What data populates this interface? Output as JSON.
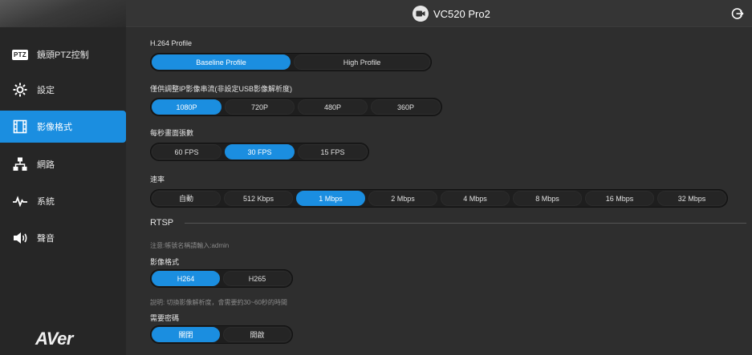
{
  "header": {
    "device_name": "VC520 Pro2"
  },
  "sidebar": {
    "items": [
      {
        "badge": "PTZ",
        "label": "鏡頭PTZ控制",
        "icon": "ptz-badge-icon"
      },
      {
        "label": "設定",
        "icon": "gear-icon"
      },
      {
        "label": "影像格式",
        "icon": "video-format-icon",
        "active": true
      },
      {
        "label": "網路",
        "icon": "network-icon"
      },
      {
        "label": "系統",
        "icon": "pulse-icon"
      },
      {
        "label": "聲音",
        "icon": "speaker-icon"
      }
    ],
    "logo": "AVer"
  },
  "h264_profile": {
    "label": "H.264 Profile",
    "options": [
      "Baseline Profile",
      "High Profile"
    ],
    "selected": "Baseline Profile"
  },
  "ip_resolution": {
    "label": "僅供調整IP影像串流(非設定USB影像解析度)",
    "options": [
      "1080P",
      "720P",
      "480P",
      "360P"
    ],
    "selected": "1080P"
  },
  "fps": {
    "label": "每秒畫面張數",
    "options": [
      "60 FPS",
      "30 FPS",
      "15 FPS"
    ],
    "selected": "30 FPS"
  },
  "bitrate": {
    "label": "速率",
    "options": [
      "自動",
      "512 Kbps",
      "1 Mbps",
      "2 Mbps",
      "4 Mbps",
      "8 Mbps",
      "16 Mbps",
      "32 Mbps"
    ],
    "selected": "1 Mbps"
  },
  "rtsp": {
    "title": "RTSP",
    "note": "注意:帳號名稱請輸入:admin",
    "video_format": {
      "label": "影像格式",
      "options": [
        "H264",
        "H265"
      ],
      "selected": "H264"
    },
    "resolution_note": "說明: 切換影像解析度，會需要約30~60秒的時間",
    "password_required": {
      "label": "需要密碼",
      "options": [
        "關閉",
        "開啟"
      ],
      "selected": "關閉"
    }
  },
  "colors": {
    "accent": "#1b8ee0",
    "background": "#2e2e2e",
    "sidebar": "#262626"
  }
}
